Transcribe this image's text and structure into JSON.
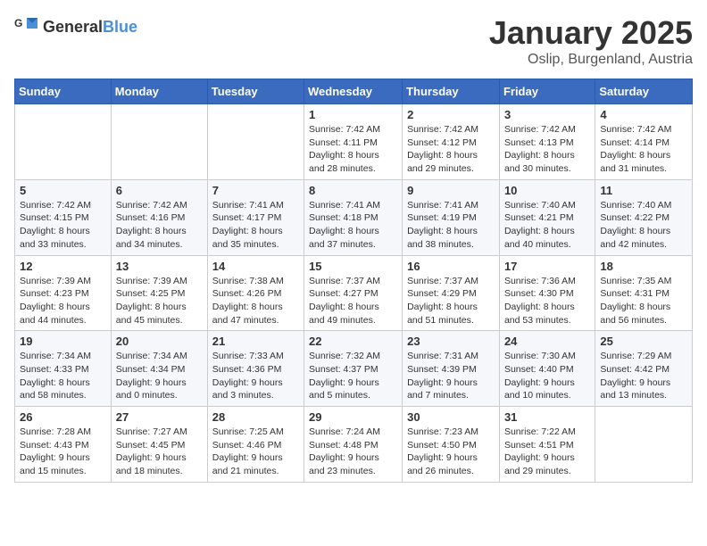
{
  "header": {
    "logo_general": "General",
    "logo_blue": "Blue",
    "title": "January 2025",
    "subtitle": "Oslip, Burgenland, Austria"
  },
  "weekdays": [
    "Sunday",
    "Monday",
    "Tuesday",
    "Wednesday",
    "Thursday",
    "Friday",
    "Saturday"
  ],
  "weeks": [
    [
      {
        "day": "",
        "info": ""
      },
      {
        "day": "",
        "info": ""
      },
      {
        "day": "",
        "info": ""
      },
      {
        "day": "1",
        "info": "Sunrise: 7:42 AM\nSunset: 4:11 PM\nDaylight: 8 hours\nand 28 minutes."
      },
      {
        "day": "2",
        "info": "Sunrise: 7:42 AM\nSunset: 4:12 PM\nDaylight: 8 hours\nand 29 minutes."
      },
      {
        "day": "3",
        "info": "Sunrise: 7:42 AM\nSunset: 4:13 PM\nDaylight: 8 hours\nand 30 minutes."
      },
      {
        "day": "4",
        "info": "Sunrise: 7:42 AM\nSunset: 4:14 PM\nDaylight: 8 hours\nand 31 minutes."
      }
    ],
    [
      {
        "day": "5",
        "info": "Sunrise: 7:42 AM\nSunset: 4:15 PM\nDaylight: 8 hours\nand 33 minutes."
      },
      {
        "day": "6",
        "info": "Sunrise: 7:42 AM\nSunset: 4:16 PM\nDaylight: 8 hours\nand 34 minutes."
      },
      {
        "day": "7",
        "info": "Sunrise: 7:41 AM\nSunset: 4:17 PM\nDaylight: 8 hours\nand 35 minutes."
      },
      {
        "day": "8",
        "info": "Sunrise: 7:41 AM\nSunset: 4:18 PM\nDaylight: 8 hours\nand 37 minutes."
      },
      {
        "day": "9",
        "info": "Sunrise: 7:41 AM\nSunset: 4:19 PM\nDaylight: 8 hours\nand 38 minutes."
      },
      {
        "day": "10",
        "info": "Sunrise: 7:40 AM\nSunset: 4:21 PM\nDaylight: 8 hours\nand 40 minutes."
      },
      {
        "day": "11",
        "info": "Sunrise: 7:40 AM\nSunset: 4:22 PM\nDaylight: 8 hours\nand 42 minutes."
      }
    ],
    [
      {
        "day": "12",
        "info": "Sunrise: 7:39 AM\nSunset: 4:23 PM\nDaylight: 8 hours\nand 44 minutes."
      },
      {
        "day": "13",
        "info": "Sunrise: 7:39 AM\nSunset: 4:25 PM\nDaylight: 8 hours\nand 45 minutes."
      },
      {
        "day": "14",
        "info": "Sunrise: 7:38 AM\nSunset: 4:26 PM\nDaylight: 8 hours\nand 47 minutes."
      },
      {
        "day": "15",
        "info": "Sunrise: 7:37 AM\nSunset: 4:27 PM\nDaylight: 8 hours\nand 49 minutes."
      },
      {
        "day": "16",
        "info": "Sunrise: 7:37 AM\nSunset: 4:29 PM\nDaylight: 8 hours\nand 51 minutes."
      },
      {
        "day": "17",
        "info": "Sunrise: 7:36 AM\nSunset: 4:30 PM\nDaylight: 8 hours\nand 53 minutes."
      },
      {
        "day": "18",
        "info": "Sunrise: 7:35 AM\nSunset: 4:31 PM\nDaylight: 8 hours\nand 56 minutes."
      }
    ],
    [
      {
        "day": "19",
        "info": "Sunrise: 7:34 AM\nSunset: 4:33 PM\nDaylight: 8 hours\nand 58 minutes."
      },
      {
        "day": "20",
        "info": "Sunrise: 7:34 AM\nSunset: 4:34 PM\nDaylight: 9 hours\nand 0 minutes."
      },
      {
        "day": "21",
        "info": "Sunrise: 7:33 AM\nSunset: 4:36 PM\nDaylight: 9 hours\nand 3 minutes."
      },
      {
        "day": "22",
        "info": "Sunrise: 7:32 AM\nSunset: 4:37 PM\nDaylight: 9 hours\nand 5 minutes."
      },
      {
        "day": "23",
        "info": "Sunrise: 7:31 AM\nSunset: 4:39 PM\nDaylight: 9 hours\nand 7 minutes."
      },
      {
        "day": "24",
        "info": "Sunrise: 7:30 AM\nSunset: 4:40 PM\nDaylight: 9 hours\nand 10 minutes."
      },
      {
        "day": "25",
        "info": "Sunrise: 7:29 AM\nSunset: 4:42 PM\nDaylight: 9 hours\nand 13 minutes."
      }
    ],
    [
      {
        "day": "26",
        "info": "Sunrise: 7:28 AM\nSunset: 4:43 PM\nDaylight: 9 hours\nand 15 minutes."
      },
      {
        "day": "27",
        "info": "Sunrise: 7:27 AM\nSunset: 4:45 PM\nDaylight: 9 hours\nand 18 minutes."
      },
      {
        "day": "28",
        "info": "Sunrise: 7:25 AM\nSunset: 4:46 PM\nDaylight: 9 hours\nand 21 minutes."
      },
      {
        "day": "29",
        "info": "Sunrise: 7:24 AM\nSunset: 4:48 PM\nDaylight: 9 hours\nand 23 minutes."
      },
      {
        "day": "30",
        "info": "Sunrise: 7:23 AM\nSunset: 4:50 PM\nDaylight: 9 hours\nand 26 minutes."
      },
      {
        "day": "31",
        "info": "Sunrise: 7:22 AM\nSunset: 4:51 PM\nDaylight: 9 hours\nand 29 minutes."
      },
      {
        "day": "",
        "info": ""
      }
    ]
  ]
}
